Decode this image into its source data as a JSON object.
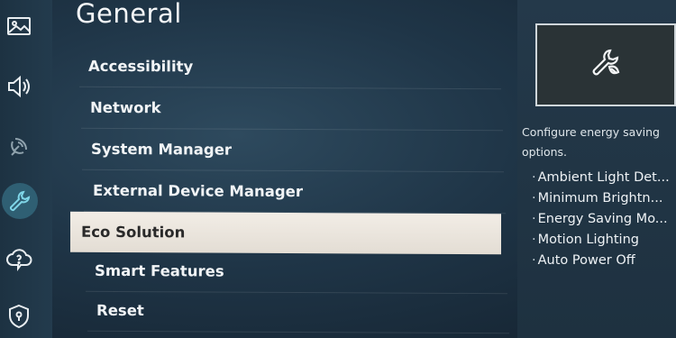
{
  "rail": {
    "icons": [
      "picture-icon",
      "sound-icon",
      "broadcast-icon",
      "general-wrench-icon",
      "support-cloud-icon",
      "privacy-shield-icon"
    ]
  },
  "menu": {
    "title": "General",
    "items": [
      {
        "label": "Accessibility"
      },
      {
        "label": "Network"
      },
      {
        "label": "System Manager"
      },
      {
        "label": "External Device Manager"
      },
      {
        "label": "Eco Solution",
        "selected": true
      },
      {
        "label": "Smart Features"
      },
      {
        "label": "Reset"
      }
    ]
  },
  "info": {
    "preview_icon": "eco-wrench-leaf-icon",
    "description": "Configure energy saving options.",
    "sub_items": [
      "Ambient Light Det...",
      "Minimum Brightn...",
      "Energy Saving Mo...",
      "Motion Lighting",
      "Auto Power Off"
    ]
  },
  "colors": {
    "background": "#1f3547",
    "selected_item": "#ece6de",
    "selected_text": "#2a2a2a",
    "text": "#f1f4f6"
  }
}
